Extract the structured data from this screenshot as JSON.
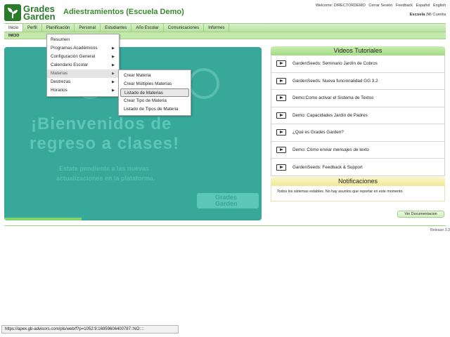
{
  "header": {
    "logo_line1": "Grades",
    "logo_line2": "Garden",
    "app_title": "Adiestramientos (Escuela Demo)",
    "welcome": "Welcome: DIRECTORDEMO",
    "logout": "Cerrar Sesión",
    "feedback": "Feedback",
    "lang_es": "Español",
    "lang_en": "English",
    "school": "Escuela",
    "separator": "|",
    "my_account": "Mi Cuenta"
  },
  "nav": {
    "tabs": [
      {
        "label": "Inicio"
      },
      {
        "label": "Perfil"
      },
      {
        "label": "Planificación"
      },
      {
        "label": "Personal"
      },
      {
        "label": "Estudiantes"
      },
      {
        "label": "Año Escolar"
      },
      {
        "label": "Comunicaciones"
      },
      {
        "label": "Informes"
      }
    ],
    "subnav": "INICIO"
  },
  "banner": {
    "heading_line1": "¡Bienvenidos de",
    "heading_line2": "regreso a clases!",
    "sub_line1": "Estate pendiente a las nuevas",
    "sub_line2": "actualizaciones en la plataforma.",
    "logo_line1": "Grades",
    "logo_line2": "Garden"
  },
  "menu_planificacion": [
    {
      "label": "Resumen",
      "arrow": ""
    },
    {
      "label": "Programas Académicos",
      "arrow": "▶"
    },
    {
      "label": "Configuración General",
      "arrow": "▶"
    },
    {
      "label": "Calendario Escolar",
      "arrow": "▶"
    },
    {
      "label": "Materias",
      "arrow": "▶"
    },
    {
      "label": "Destrezas",
      "arrow": "▶"
    },
    {
      "label": "Horarios",
      "arrow": "▶"
    }
  ],
  "menu_materias": [
    {
      "label": "Crear Materia"
    },
    {
      "label": "Crear Múltiples Materias"
    },
    {
      "label": "Listado de Materias"
    },
    {
      "label": "Crear Tipo de Materia"
    },
    {
      "label": "Listado de Tipos de Materia"
    }
  ],
  "videos": {
    "title": "Videos Tutoriales",
    "items": [
      {
        "label": "GardenSeeds: Seminario Jardín de Cobros"
      },
      {
        "label": "GardenSeeds: Nueva funcionalidad GG 3.2"
      },
      {
        "label": "Demo:Como activar el Sistema de Textos"
      },
      {
        "label": "Demo: Capacidades Jardín de Padres"
      },
      {
        "label": "¿Qué es Grades Garden?"
      },
      {
        "label": "Demo: Cómo enviar mensajes de texto"
      },
      {
        "label": "GardenSeeds: Feedback & Support"
      }
    ]
  },
  "notifications": {
    "title": "Notificaciones",
    "message": "Todos los sistemas estables. No hay asuntos que reportar en este momento."
  },
  "doc_button": "Ver Documentacion",
  "release": "Release 3.3",
  "statusbar": "https://apex.gb-advisors.com/pls/web/f?p=1052:9:16959606400787::NO::::",
  "colors": {
    "brand_green": "#2c7a2c",
    "nav_green": "#b8e2a0",
    "banner_teal": "#37a89a",
    "notif_yellow": "#f2e99a"
  }
}
